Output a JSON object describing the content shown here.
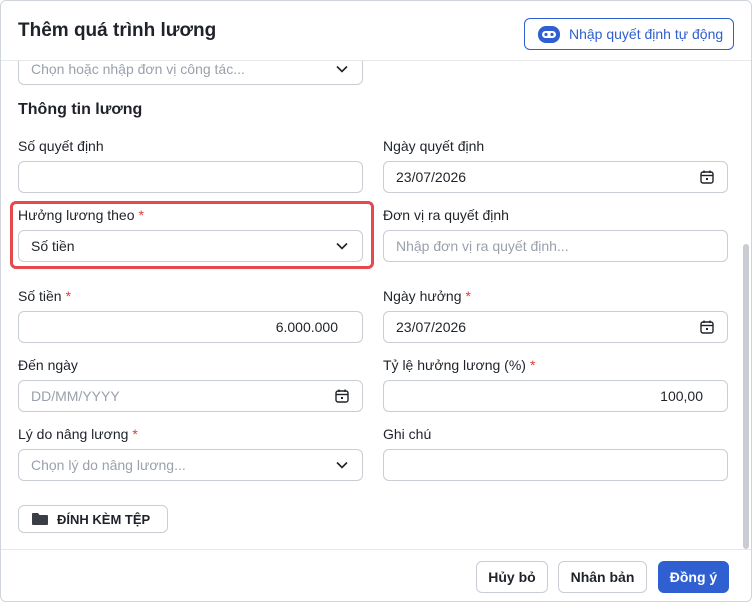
{
  "header": {
    "title": "Thêm quá trình lương",
    "auto_button_label": "Nhập quyết định tự động"
  },
  "work_unit": {
    "placeholder": "Chọn hoặc nhập đơn vị công tác..."
  },
  "section_title": "Thông tin lương",
  "fields": {
    "decision_number": {
      "label": "Số quyết định",
      "value": ""
    },
    "decision_date": {
      "label": "Ngày quyết định",
      "value": "23/07/2026"
    },
    "salary_basis": {
      "label": "Hưởng lương theo",
      "required": "*",
      "value": "Số tiền"
    },
    "issuing_unit": {
      "label": "Đơn vị ra quyết định",
      "placeholder": "Nhập đơn vị ra quyết định..."
    },
    "amount": {
      "label": "Số tiền",
      "required": "*",
      "value": "6.000.000"
    },
    "effective_date": {
      "label": "Ngày hưởng",
      "required": "*",
      "value": "23/07/2026"
    },
    "end_date": {
      "label": "Đến ngày",
      "placeholder": "DD/MM/YYYY"
    },
    "salary_ratio": {
      "label": "Tỷ lệ hưởng lương (%)",
      "required": "*",
      "value": "100,00"
    },
    "raise_reason": {
      "label": "Lý do nâng lương",
      "required": "*",
      "placeholder": "Chọn lý do nâng lương..."
    },
    "note": {
      "label": "Ghi chú",
      "value": ""
    }
  },
  "attach_label": "ĐÍNH KÈM TỆP",
  "footer": {
    "cancel": "Hủy bỏ",
    "duplicate": "Nhân bản",
    "confirm": "Đồng ý"
  },
  "colors": {
    "primary": "#2f5fd0",
    "required": "#e03b3b",
    "highlight": "#e5484d"
  },
  "icons": [
    "robot-icon",
    "chevron-down-icon",
    "calendar-icon",
    "folder-icon"
  ]
}
